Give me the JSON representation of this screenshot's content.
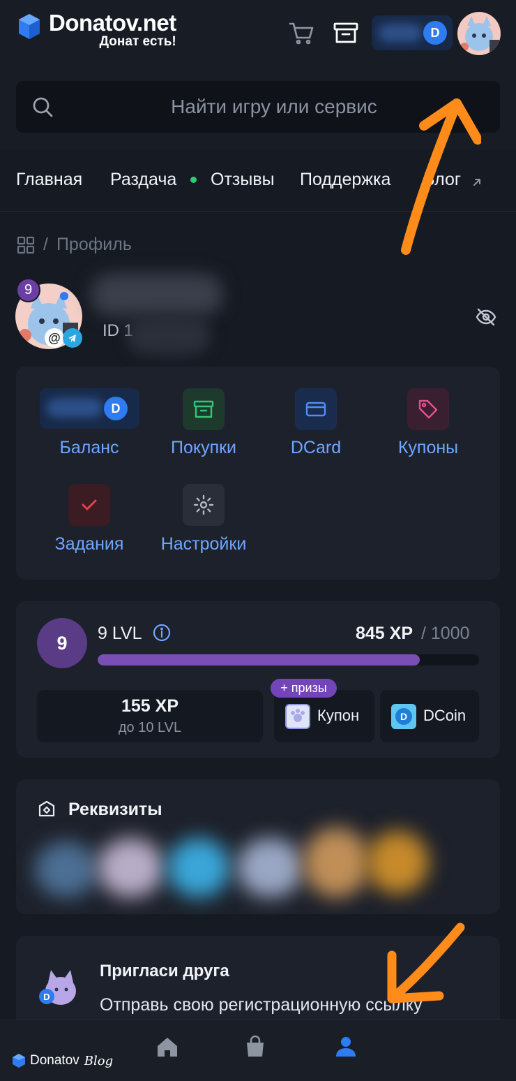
{
  "header": {
    "brand_name": "Donatov.net",
    "brand_tagline": "Донат есть!",
    "search_placeholder": "Найти игру или сервис"
  },
  "nav": {
    "items": [
      {
        "label": "Главная"
      },
      {
        "label": "Раздача"
      },
      {
        "label": "Отзывы"
      },
      {
        "label": "Поддержка"
      },
      {
        "label": "Блог"
      }
    ]
  },
  "breadcrumb": {
    "current": "Профиль",
    "separator": "/"
  },
  "profile": {
    "level_badge": "9",
    "id_prefix": "ID 1"
  },
  "menu": {
    "balance": "Баланс",
    "purchases": "Покупки",
    "dcard": "DCard",
    "coupons": "Купоны",
    "tasks": "Задания",
    "settings": "Настройки"
  },
  "level": {
    "circle": "9",
    "label": "9 LVL",
    "xp_current": "845 XP",
    "xp_max": "/ 1000",
    "progress": 0.845,
    "remaining_xp": "155 XP",
    "next_level": "до 10 LVL",
    "prizes_badge": "+ призы",
    "reward_coupon": "Купон",
    "reward_dcoin": "DCoin"
  },
  "requisites": {
    "title": "Реквизиты"
  },
  "invite": {
    "title": "Пригласи друга",
    "text": "Отправь свою регистрационную ссылку"
  },
  "footer": {
    "brand": "Donatov",
    "blog": "Blog"
  },
  "colors": {
    "accent_blue": "#6fa6ff",
    "level_purple": "#7a4fb5",
    "annotation_arrow": "#ff8c1a",
    "online_dot": "#2ecc71"
  }
}
